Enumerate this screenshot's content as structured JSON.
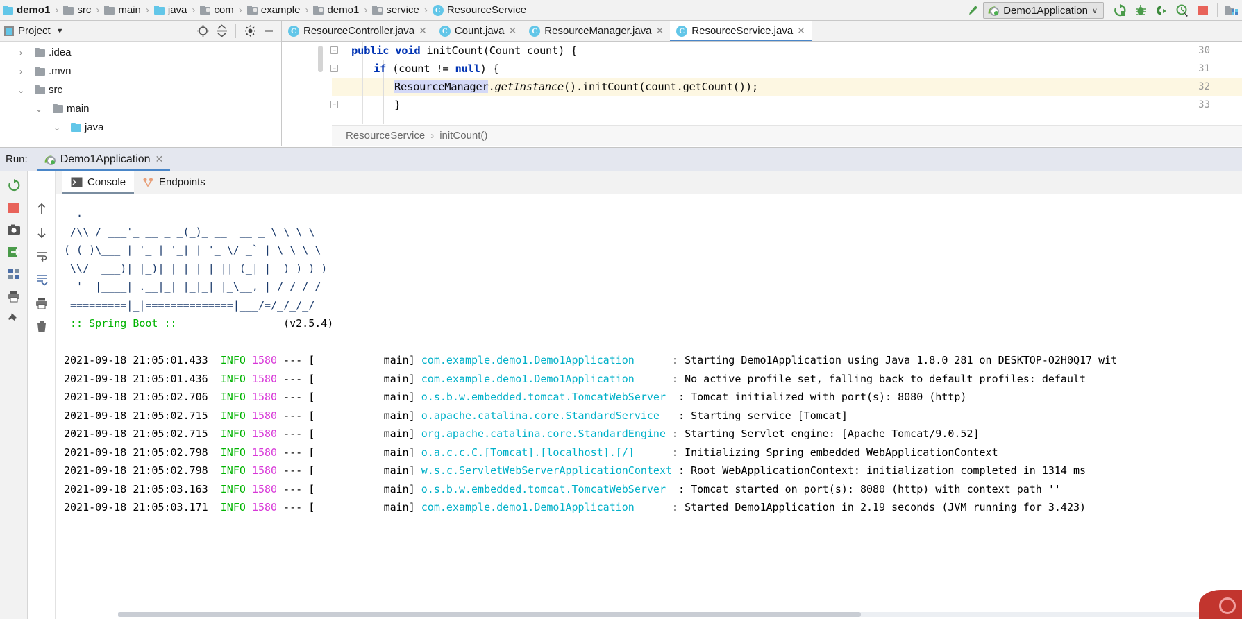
{
  "breadcrumb": {
    "items": [
      {
        "label": "demo1",
        "icon": "module-icon",
        "bold": true
      },
      {
        "label": "src",
        "icon": "folder-icon"
      },
      {
        "label": "main",
        "icon": "folder-icon"
      },
      {
        "label": "java",
        "icon": "source-folder-icon"
      },
      {
        "label": "com",
        "icon": "package-icon"
      },
      {
        "label": "example",
        "icon": "package-icon"
      },
      {
        "label": "demo1",
        "icon": "package-icon"
      },
      {
        "label": "service",
        "icon": "package-icon"
      },
      {
        "label": "ResourceService",
        "icon": "class-icon"
      }
    ],
    "separator": "›"
  },
  "toolbar": {
    "build_icon": "hammer-icon",
    "run_config": {
      "label": "Demo1Application",
      "icon": "spring-leaf-icon",
      "chevron": "∨"
    },
    "actions": [
      {
        "name": "run-button",
        "icon": "run-icon"
      },
      {
        "name": "debug-button",
        "icon": "debug-bug-icon"
      },
      {
        "name": "run-with-coverage-button",
        "icon": "run-coverage-icon"
      },
      {
        "name": "profiler-button",
        "icon": "profiler-clock-icon"
      },
      {
        "name": "stop-button",
        "icon": "stop-square-icon"
      },
      {
        "name": "project-structure-button",
        "icon": "project-structure-icon"
      }
    ]
  },
  "project_panel": {
    "title": "Project",
    "title_chevron": "▼",
    "header_icons": [
      {
        "name": "locate-icon",
        "glyph": "⊕"
      },
      {
        "name": "collapse-all-icon",
        "glyph": "⩥"
      },
      {
        "name": "settings-gear-icon",
        "glyph": "⚙"
      },
      {
        "name": "hide-panel-icon",
        "glyph": "—"
      }
    ],
    "tree": [
      {
        "label": ".idea",
        "indent": 1,
        "arrow": "›",
        "icon": "folder-icon",
        "expanded": false
      },
      {
        "label": ".mvn",
        "indent": 1,
        "arrow": "›",
        "icon": "folder-icon",
        "expanded": false
      },
      {
        "label": "src",
        "indent": 1,
        "arrow": "⌄",
        "icon": "folder-icon",
        "expanded": true
      },
      {
        "label": "main",
        "indent": 2,
        "arrow": "⌄",
        "icon": "folder-icon",
        "expanded": true
      },
      {
        "label": "java",
        "indent": 3,
        "arrow": "⌄",
        "icon": "source-folder-icon",
        "expanded": true
      }
    ]
  },
  "editor": {
    "tabs": [
      {
        "label": "ResourceController.java",
        "icon": "class-icon",
        "close": "✕",
        "active": false
      },
      {
        "label": "Count.java",
        "icon": "class-icon",
        "close": "✕",
        "active": false
      },
      {
        "label": "ResourceManager.java",
        "icon": "class-icon",
        "close": "✕",
        "active": false
      },
      {
        "label": "ResourceService.java",
        "icon": "class-icon",
        "close": "✕",
        "active": true
      }
    ],
    "lines": [
      {
        "num": "30",
        "fold": "−"
      },
      {
        "num": "31",
        "fold": "−"
      },
      {
        "num": "32",
        "fold": ""
      },
      {
        "num": "33",
        "fold": "−"
      }
    ],
    "code": {
      "l30_kw1": "public",
      "l30_kw2": "void",
      "l30_rest": " initCount(Count count) {",
      "l31_kw1": "if",
      "l31_mid": " (count != ",
      "l31_kw2": "null",
      "l31_end": ") {",
      "l32_sel": "ResourceManager",
      "l32_dot": ".",
      "l32_ital": "getInstance",
      "l32_rest": "().initCount(count.getCount());",
      "l33": "}"
    },
    "breadcrumb": {
      "class": "ResourceService",
      "separator": "›",
      "method": "initCount()"
    }
  },
  "run_panel": {
    "label": "Run:",
    "tab": {
      "label": "Demo1Application",
      "icon": "spring-leaf-icon",
      "close": "✕"
    },
    "side_actions": [
      {
        "name": "rerun-button",
        "icon": "rerun-icon"
      },
      {
        "name": "stop-button",
        "icon": "stop-square-icon"
      },
      {
        "name": "screenshot-button",
        "icon": "camera-icon"
      },
      {
        "name": "export-button",
        "icon": "export-icon"
      },
      {
        "name": "layout-button",
        "icon": "layout-icon"
      },
      {
        "name": "print-button",
        "icon": "printer-icon"
      },
      {
        "name": "pin-button",
        "icon": "pin-icon"
      }
    ],
    "side_actions2": [
      {
        "name": "scroll-up-button",
        "icon": "arrow-up-icon"
      },
      {
        "name": "scroll-down-button",
        "icon": "arrow-down-icon"
      },
      {
        "name": "soft-wrap-button",
        "icon": "wrap-icon"
      },
      {
        "name": "scroll-to-end-button",
        "icon": "scroll-end-icon"
      },
      {
        "name": "print-console-button",
        "icon": "printer-icon"
      },
      {
        "name": "clear-all-button",
        "icon": "trash-icon"
      }
    ],
    "console_tabs": [
      {
        "label": "Console",
        "icon": "console-icon",
        "active": true
      },
      {
        "label": "Endpoints",
        "icon": "endpoints-icon",
        "active": false
      }
    ]
  },
  "console": {
    "banner": [
      "  .   ____          _            __ _ _",
      " /\\\\ / ___'_ __ _ _(_)_ __  __ _ \\ \\ \\ \\",
      "( ( )\\___ | '_ | '_| | '_ \\/ _` | \\ \\ \\ \\",
      " \\\\/  ___)| |_)| | | | | || (_| |  ) ) ) )",
      "  '  |____| .__|_| |_|_| |_\\__, | / / / /",
      " =========|_|==============|___/=/_/_/_/"
    ],
    "spring_line": " :: Spring Boot ::",
    "version": "(v2.5.4)",
    "logs": [
      {
        "ts": "2021-09-18 21:05:01.433",
        "level": "INFO",
        "pid": "1580",
        "sep": "--- [",
        "thread": "main]",
        "logger": "com.example.demo1.Demo1Application",
        "msg": ": Starting Demo1Application using Java 1.8.0_281 on DESKTOP-O2H0Q17 wit"
      },
      {
        "ts": "2021-09-18 21:05:01.436",
        "level": "INFO",
        "pid": "1580",
        "sep": "--- [",
        "thread": "main]",
        "logger": "com.example.demo1.Demo1Application",
        "msg": ": No active profile set, falling back to default profiles: default"
      },
      {
        "ts": "2021-09-18 21:05:02.706",
        "level": "INFO",
        "pid": "1580",
        "sep": "--- [",
        "thread": "main]",
        "logger": "o.s.b.w.embedded.tomcat.TomcatWebServer",
        "msg": ": Tomcat initialized with port(s): 8080 (http)"
      },
      {
        "ts": "2021-09-18 21:05:02.715",
        "level": "INFO",
        "pid": "1580",
        "sep": "--- [",
        "thread": "main]",
        "logger": "o.apache.catalina.core.StandardService",
        "msg": ": Starting service [Tomcat]"
      },
      {
        "ts": "2021-09-18 21:05:02.715",
        "level": "INFO",
        "pid": "1580",
        "sep": "--- [",
        "thread": "main]",
        "logger": "org.apache.catalina.core.StandardEngine",
        "msg": ": Starting Servlet engine: [Apache Tomcat/9.0.52]"
      },
      {
        "ts": "2021-09-18 21:05:02.798",
        "level": "INFO",
        "pid": "1580",
        "sep": "--- [",
        "thread": "main]",
        "logger": "o.a.c.c.C.[Tomcat].[localhost].[/]",
        "msg": ": Initializing Spring embedded WebApplicationContext"
      },
      {
        "ts": "2021-09-18 21:05:02.798",
        "level": "INFO",
        "pid": "1580",
        "sep": "--- [",
        "thread": "main]",
        "logger": "w.s.c.ServletWebServerApplicationContext",
        "msg": ": Root WebApplicationContext: initialization completed in 1314 ms"
      },
      {
        "ts": "2021-09-18 21:05:03.163",
        "level": "INFO",
        "pid": "1580",
        "sep": "--- [",
        "thread": "main]",
        "logger": "o.s.b.w.embedded.tomcat.TomcatWebServer",
        "msg": ": Tomcat started on port(s): 8080 (http) with context path ''"
      },
      {
        "ts": "2021-09-18 21:05:03.171",
        "level": "INFO",
        "pid": "1580",
        "sep": "--- [",
        "thread": "main]",
        "logger": "com.example.demo1.Demo1Application",
        "msg": ": Started Demo1Application in 2.19 seconds (JVM running for 3.423)"
      }
    ]
  },
  "colors": {
    "accent_blue": "#4a86c8",
    "info_green": "#00b300",
    "pid_magenta": "#d837d8",
    "logger_cyan": "#00b0c8",
    "keyword_blue": "#0033b3",
    "highlight_yellow": "#fdf7e2",
    "stop_red": "#e8635a"
  }
}
